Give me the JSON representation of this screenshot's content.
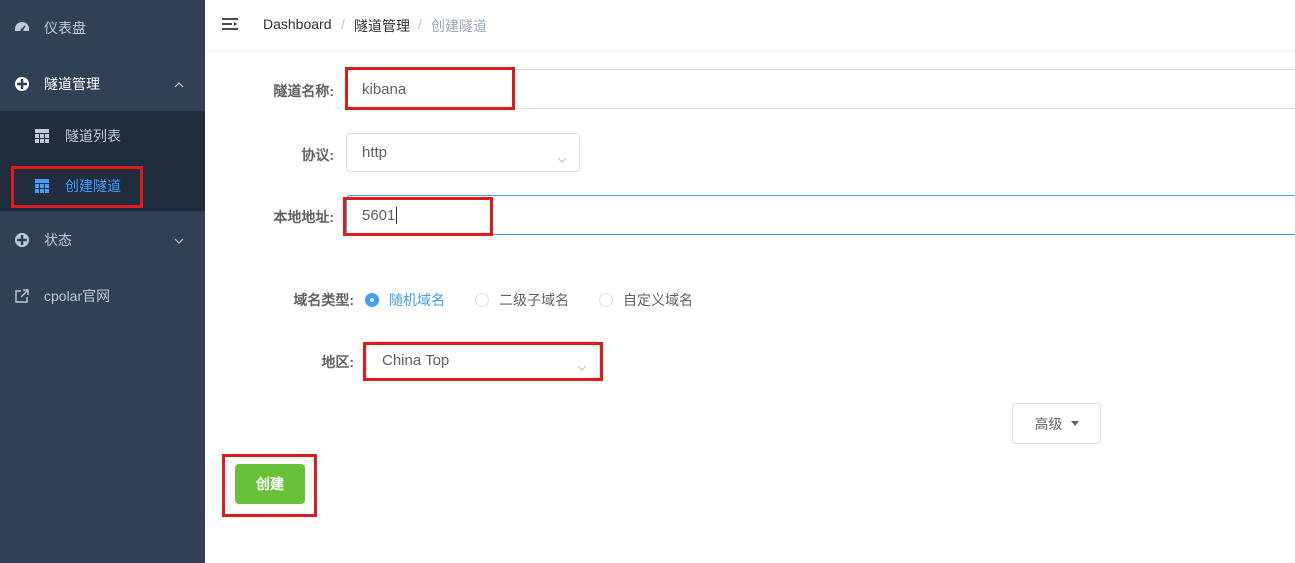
{
  "sidebar": {
    "items": [
      {
        "label": "仪表盘",
        "icon": "dashboard-icon"
      },
      {
        "label": "隧道管理",
        "icon": "tunnel-icon",
        "expanded": true
      },
      {
        "label": "状态",
        "icon": "status-icon"
      },
      {
        "label": "cpolar官网",
        "icon": "external-link-icon"
      }
    ],
    "submenu": [
      {
        "label": "隧道列表",
        "icon": "table-icon"
      },
      {
        "label": "创建隧道",
        "icon": "table-icon",
        "active": true
      }
    ]
  },
  "header": {
    "breadcrumb": [
      "Dashboard",
      "隧道管理",
      "创建隧道"
    ],
    "separator": "/"
  },
  "form": {
    "name_label": "隧道名称:",
    "name_value": "kibana",
    "protocol_label": "协议:",
    "protocol_value": "http",
    "local_label": "本地地址:",
    "local_value": "5601",
    "domain_type_label": "域名类型:",
    "domain_options": [
      "随机域名",
      "二级子域名",
      "自定义域名"
    ],
    "domain_selected": "随机域名",
    "region_label": "地区:",
    "region_value": "China Top",
    "advanced_label": "高级",
    "create_label": "创建"
  },
  "colors": {
    "sidebar_bg": "#304156",
    "submenu_bg": "#1f2d3d",
    "accent": "#409eff",
    "create_button": "#67c23a",
    "highlight_box": "#e01b1b"
  }
}
